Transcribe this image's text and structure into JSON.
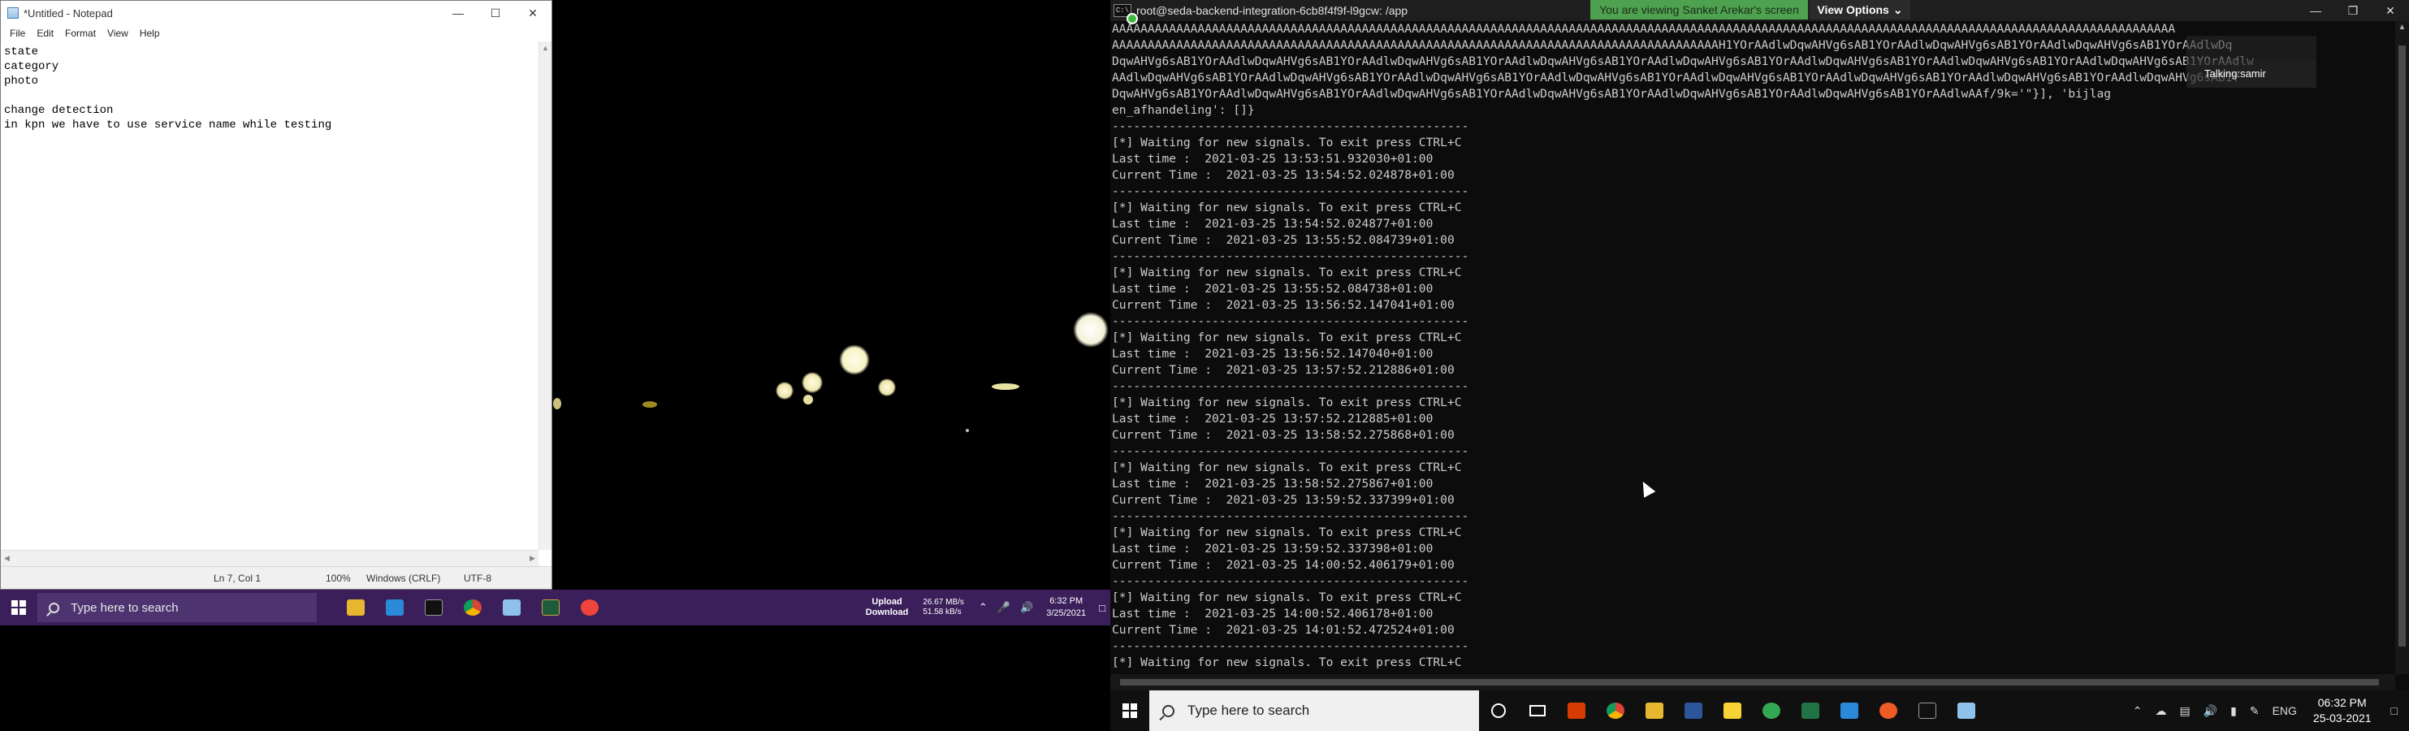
{
  "left": {
    "notepad": {
      "title": "*Untitled - Notepad",
      "menu": [
        "File",
        "Edit",
        "Format",
        "View",
        "Help"
      ],
      "content": "state\ncategory\nphoto\n\nchange detection\nin kpn we have to use service name while testing",
      "status": {
        "position": "Ln 7, Col 1",
        "zoom": "100%",
        "line_ending": "Windows (CRLF)",
        "encoding": "UTF-8"
      }
    },
    "taskbar": {
      "search_placeholder": "Type here to search",
      "upload_label": "Upload",
      "download_label": "Download",
      "upload_speed": "26.67 MB/s",
      "download_speed": "51.58 kB/s",
      "time": "6:32 PM",
      "date": "3/25/2021",
      "pinned": [
        "file-explorer",
        "vscode",
        "terminal",
        "chrome",
        "notepad",
        "app",
        "anydesk"
      ],
      "colors": {
        "background": "#3a1f5a"
      }
    }
  },
  "right": {
    "terminal": {
      "title": "root@seda-backend-integration-6cb8f4f9f-l9gcw: /app",
      "share_banner": "You are viewing Sanket Arekar's screen",
      "view_options": "View Options",
      "talking_label": "Talking:samir",
      "lines": [
        "AAAAAAAAAAAAAAAAAAAAAAAAAAAAAAAAAAAAAAAAAAAAAAAAAAAAAAAAAAAAAAAAAAAAAAAAAAAAAAAAAAAAAAAAAAAAAAAAAAAAAAAAAAAAAAAAAAAAAAAAAAAAAAAAAAAAAAAAAAAAAAAAAAAAA",
        "AAAAAAAAAAAAAAAAAAAAAAAAAAAAAAAAAAAAAAAAAAAAAAAAAAAAAAAAAAAAAAAAAAAAAAAAAAAAAAAAAAAAAH1YOrAAdlwDqwAHVg6sAB1YOrAAdlwDqwAHVg6sAB1YOrAAdlwDqwAHVg6sAB1YOrAAdlwDq",
        "DqwAHVg6sAB1YOrAAdlwDqwAHVg6sAB1YOrAAdlwDqwAHVg6sAB1YOrAAdlwDqwAHVg6sAB1YOrAAdlwDqwAHVg6sAB1YOrAAdlwDqwAHVg6sAB1YOrAAdlwDqwAHVg6sAB1YOrAAdlwDqwAHVg6sAB1YOrAAdlw",
        "AAdlwDqwAHVg6sAB1YOrAAdlwDqwAHVg6sAB1YOrAAdlwDqwAHVg6sAB1YOrAAdlwDqwAHVg6sAB1YOrAAdlwDqwAHVg6sAB1YOrAAdlwDqwAHVg6sAB1YOrAAdlwDqwAHVg6sAB1YOrAAdlwDqwAHVg6sAB1Y",
        "DqwAHVg6sAB1YOrAAdlwDqwAHVg6sAB1YOrAAdlwDqwAHVg6sAB1YOrAAdlwDqwAHVg6sAB1YOrAAdlwDqwAHVg6sAB1YOrAAdlwDqwAHVg6sAB1YOrAAdlwAAf/9k='\"}], 'bijlag",
        "en_afhandeling': []}",
        "--------------------------------------------------",
        "[*] Waiting for new signals. To exit press CTRL+C",
        "Last time :  2021-03-25 13:53:51.932030+01:00",
        "Current Time :  2021-03-25 13:54:52.024878+01:00",
        "--------------------------------------------------",
        "[*] Waiting for new signals. To exit press CTRL+C",
        "Last time :  2021-03-25 13:54:52.024877+01:00",
        "Current Time :  2021-03-25 13:55:52.084739+01:00",
        "--------------------------------------------------",
        "[*] Waiting for new signals. To exit press CTRL+C",
        "Last time :  2021-03-25 13:55:52.084738+01:00",
        "Current Time :  2021-03-25 13:56:52.147041+01:00",
        "--------------------------------------------------",
        "[*] Waiting for new signals. To exit press CTRL+C",
        "Last time :  2021-03-25 13:56:52.147040+01:00",
        "Current Time :  2021-03-25 13:57:52.212886+01:00",
        "--------------------------------------------------",
        "[*] Waiting for new signals. To exit press CTRL+C",
        "Last time :  2021-03-25 13:57:52.212885+01:00",
        "Current Time :  2021-03-25 13:58:52.275868+01:00",
        "--------------------------------------------------",
        "[*] Waiting for new signals. To exit press CTRL+C",
        "Last time :  2021-03-25 13:58:52.275867+01:00",
        "Current Time :  2021-03-25 13:59:52.337399+01:00",
        "--------------------------------------------------",
        "[*] Waiting for new signals. To exit press CTRL+C",
        "Last time :  2021-03-25 13:59:52.337398+01:00",
        "Current Time :  2021-03-25 14:00:52.406179+01:00",
        "--------------------------------------------------",
        "[*] Waiting for new signals. To exit press CTRL+C",
        "Last time :  2021-03-25 14:00:52.406178+01:00",
        "Current Time :  2021-03-25 14:01:52.472524+01:00",
        "--------------------------------------------------",
        "[*] Waiting for new signals. To exit press CTRL+C"
      ]
    },
    "taskbar": {
      "search_placeholder": "Type here to search",
      "language": "ENG",
      "time": "06:32 PM",
      "date": "25-03-2021",
      "pinned": [
        "cortana",
        "task-view",
        "office",
        "chrome",
        "file-explorer",
        "word",
        "sticky-notes",
        "hub",
        "excel",
        "vscode",
        "postman",
        "terminal",
        "app"
      ],
      "colors": {
        "background": "#101010",
        "banner": "#4ea14e"
      }
    }
  }
}
